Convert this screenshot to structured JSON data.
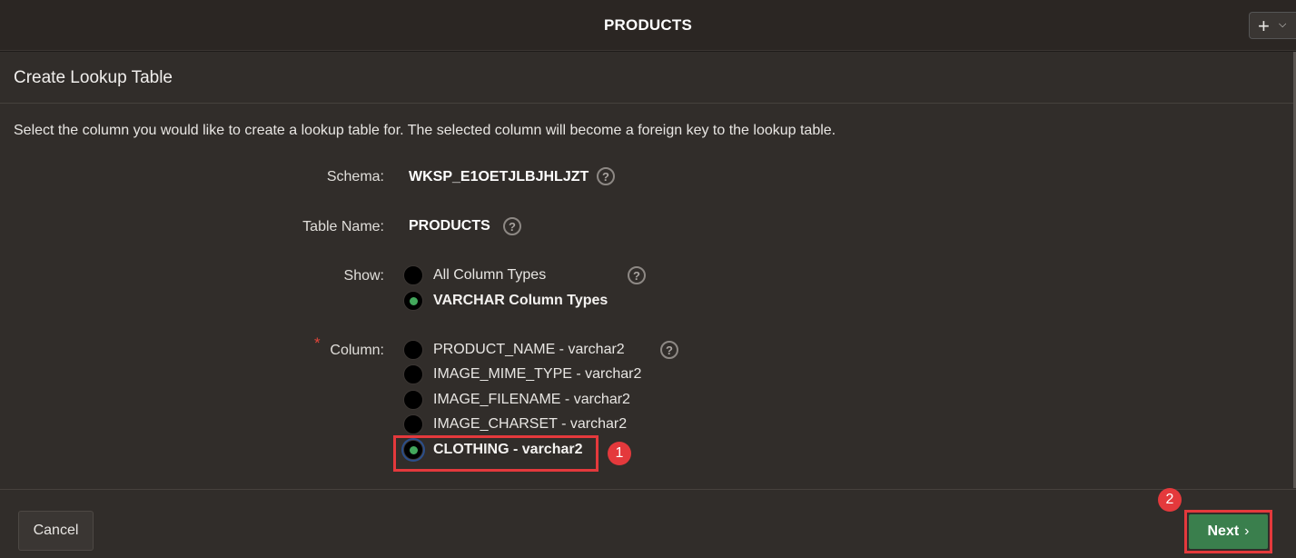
{
  "topbar": {
    "title": "PRODUCTS",
    "add_icon": "plus-icon",
    "menu_icon": "chevron-down-icon"
  },
  "dialog": {
    "title": "Create Lookup Table",
    "instruction": "Select the column you would like to create a lookup table for. The selected column will become a foreign key to the lookup table.",
    "fields": {
      "schema": {
        "label": "Schema:",
        "value": "WKSP_E1OETJLBJHLJZT"
      },
      "table_name": {
        "label": "Table Name:",
        "value": "PRODUCTS"
      },
      "show": {
        "label": "Show:",
        "options": [
          "All Column Types",
          "VARCHAR Column Types"
        ],
        "selected": "VARCHAR Column Types"
      },
      "column": {
        "label": "Column:",
        "required_marker": "*",
        "options": [
          "PRODUCT_NAME - varchar2",
          "IMAGE_MIME_TYPE - varchar2",
          "IMAGE_FILENAME - varchar2",
          "IMAGE_CHARSET - varchar2",
          "CLOTHING - varchar2"
        ],
        "selected": "CLOTHING - varchar2"
      }
    },
    "help_icon_glyph": "?",
    "footer": {
      "cancel_label": "Cancel",
      "next_label": "Next",
      "next_icon": "›"
    }
  },
  "annotations": {
    "step1": "1",
    "step2": "2",
    "highlight_color": "#e4393c"
  },
  "colors": {
    "accent_green": "#3a7f4d",
    "radio_selected": "#43a85c",
    "background": "#312d2a"
  }
}
